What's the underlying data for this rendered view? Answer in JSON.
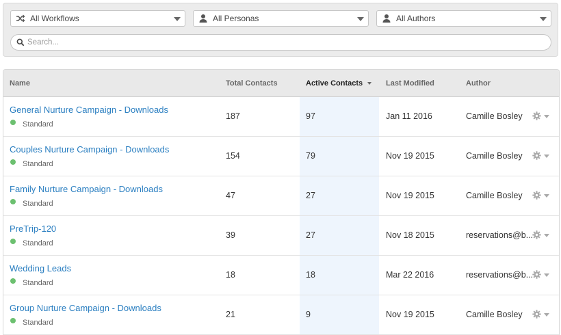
{
  "filters": {
    "workflows": {
      "selected": "All Workflows",
      "icon": "shuffle-icon"
    },
    "personas": {
      "selected": "All Personas",
      "icon": "person-icon"
    },
    "authors": {
      "selected": "All Authors",
      "icon": "person-icon"
    }
  },
  "search": {
    "placeholder": "Search...",
    "value": ""
  },
  "table": {
    "columns": {
      "name": "Name",
      "total_contacts": "Total Contacts",
      "active_contacts": "Active Contacts",
      "last_modified": "Last Modified",
      "author": "Author"
    },
    "sorted_column": "active_contacts",
    "status_color": "#6cc070",
    "link_color": "#2b7fc1",
    "rows": [
      {
        "name": "General Nurture Campaign - Downloads",
        "status": "Standard",
        "total": "187",
        "active": "97",
        "modified": "Jan 11 2016",
        "author": "Camille Bosley"
      },
      {
        "name": "Couples Nurture Campaign - Downloads",
        "status": "Standard",
        "total": "154",
        "active": "79",
        "modified": "Nov 19 2015",
        "author": "Camille Bosley"
      },
      {
        "name": "Family Nurture Campaign - Downloads",
        "status": "Standard",
        "total": "47",
        "active": "27",
        "modified": "Nov 19 2015",
        "author": "Camille Bosley"
      },
      {
        "name": "PreTrip-120",
        "status": "Standard",
        "total": "39",
        "active": "27",
        "modified": "Nov 18 2015",
        "author": "reservations@b..."
      },
      {
        "name": "Wedding Leads",
        "status": "Standard",
        "total": "18",
        "active": "18",
        "modified": "Mar 22 2016",
        "author": "reservations@b..."
      },
      {
        "name": "Group Nurture Campaign - Downloads",
        "status": "Standard",
        "total": "21",
        "active": "9",
        "modified": "Nov 19 2015",
        "author": "Camille Bosley"
      }
    ]
  }
}
